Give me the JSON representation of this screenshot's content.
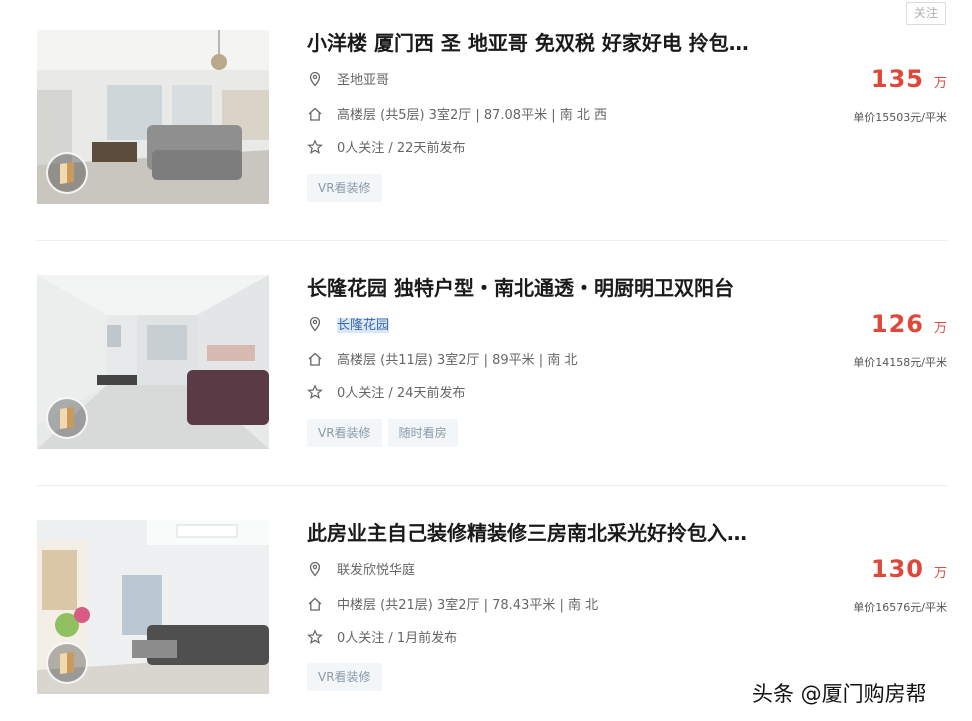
{
  "follow_label": "关注",
  "listings": [
    {
      "title": "小洋楼 厦门西 圣 地亚哥 免双税 好家好电 拎包…",
      "community": "圣地亚哥",
      "info": "高楼层 (共5层) 3室2厅 | 87.08平米 | 南 北 西",
      "meta": "0人关注 / 22天前发布",
      "tags": [
        "VR看装修"
      ],
      "price": "135",
      "price_unit": "万",
      "unit_price": "单价15503元/平米"
    },
    {
      "title": "长隆花园 独特户型・南北通透・明厨明卫双阳台",
      "community": "长隆花园",
      "info": "高楼层 (共11层) 3室2厅 | 89平米 | 南 北",
      "meta": "0人关注 / 24天前发布",
      "tags": [
        "VR看装修",
        "随时看房"
      ],
      "price": "126",
      "price_unit": "万",
      "unit_price": "单价14158元/平米"
    },
    {
      "title": "此房业主自己装修精装修三房南北采光好拎包入…",
      "community": "联发欣悦华庭",
      "info": "中楼层 (共21层) 3室2厅 | 78.43平米 | 南 北",
      "meta": "0人关注 / 1月前发布",
      "tags": [
        "VR看装修"
      ],
      "price": "130",
      "price_unit": "万",
      "unit_price": "单价16576元/平米"
    }
  ],
  "watermark": "头条 @厦门购房帮",
  "icons": {
    "location": "location-pin-icon",
    "house": "house-icon",
    "star": "star-icon",
    "vr": "vr-panorama-icon"
  },
  "colors": {
    "price": "#e0473b",
    "tag_bg": "#f3f6f8",
    "tag_text": "#8a9aa8"
  }
}
